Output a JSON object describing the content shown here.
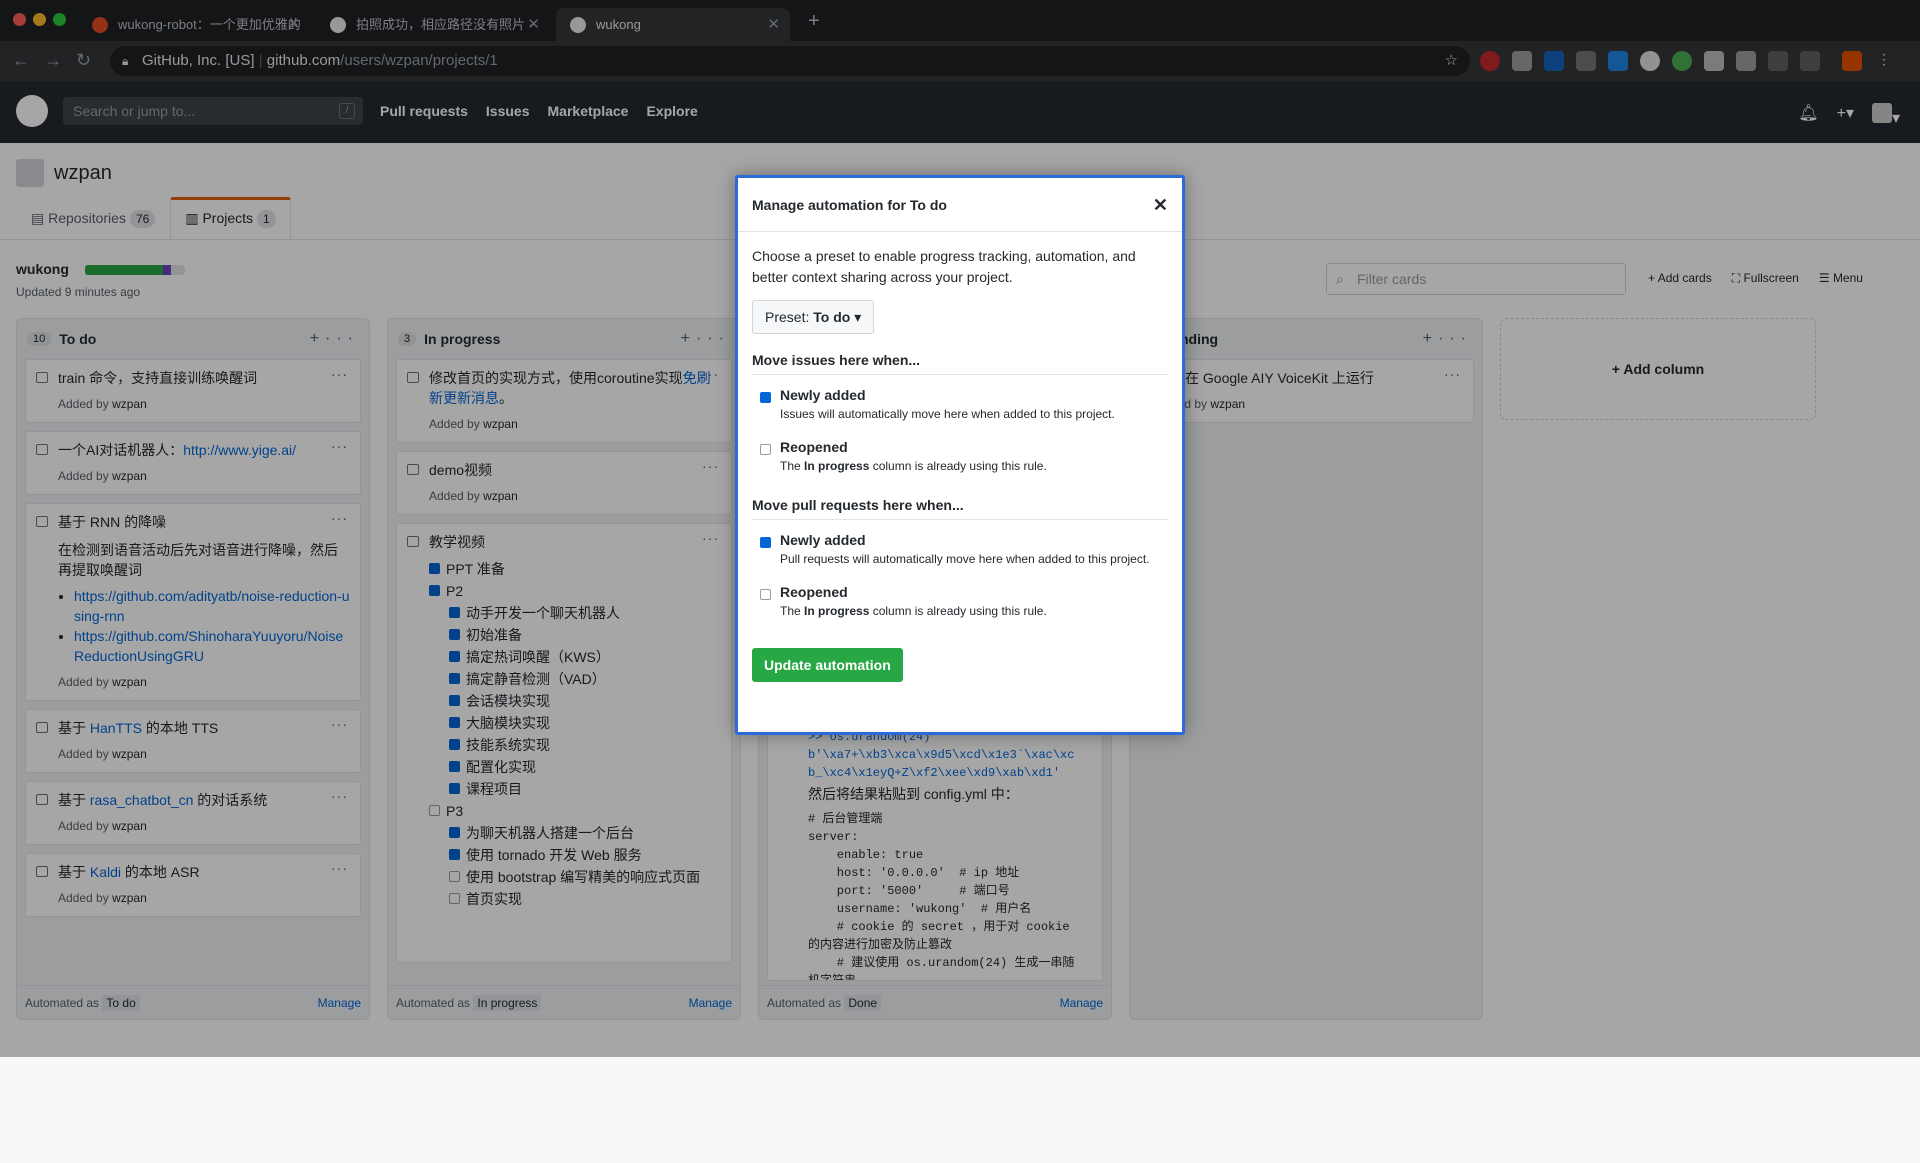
{
  "browser": {
    "tabs": [
      {
        "title": "wukong-robot：一个更加优雅的"
      },
      {
        "title": "拍照成功，相应路径没有照片 · "
      },
      {
        "title": "wukong"
      }
    ],
    "security_label": "GitHub, Inc. [US]",
    "url_host": "github.com",
    "url_path": "/users/wzpan/projects/1"
  },
  "gh": {
    "search_placeholder": "Search or jump to...",
    "search_key": "/",
    "nav": [
      "Pull requests",
      "Issues",
      "Marketplace",
      "Explore"
    ]
  },
  "user": {
    "name": "wzpan",
    "tabs": [
      {
        "label": "Repositories",
        "count": "76"
      },
      {
        "label": "Projects",
        "count": "1"
      }
    ]
  },
  "project": {
    "name": "wukong",
    "progress_done": 0.78,
    "progress_in_progress": 0.08,
    "updated": "Updated 9 minutes ago",
    "filter_placeholder": "Filter cards",
    "actions": [
      "Add cards",
      "Fullscreen",
      "Menu"
    ]
  },
  "columns": {
    "todo": {
      "count": "10",
      "title": "To do",
      "cards": [
        {
          "text": "train 命令，支持直接训练唤醒词",
          "by_prefix": "Added by",
          "by": "wzpan"
        },
        {
          "text": "一个AI对话机器人：",
          "link": "http://www.yige.ai/",
          "by_prefix": "Added by",
          "by": "wzpan"
        },
        {
          "text": "基于 RNN 的降噪",
          "body": "在检测到语音活动后先对语音进行降噪，然后再提取唤醒词",
          "links": [
            "https://github.com/adityatb/noise-reduction-using-rnn",
            "https://github.com/ShinoharaYuuyoru/NoiseReductionUsingGRU"
          ],
          "by_prefix": "Added by",
          "by": "wzpan"
        },
        {
          "pre": "基于 ",
          "link": "HanTTS",
          "post": " 的本地 TTS",
          "by_prefix": "Added by",
          "by": "wzpan"
        },
        {
          "pre": "基于 ",
          "link": "rasa_chatbot_cn",
          "post": " 的对话系统",
          "by_prefix": "Added by",
          "by": "wzpan"
        },
        {
          "pre": "基于 ",
          "link": "Kaldi",
          "post": " 的本地 ASR",
          "by_prefix": "Added by",
          "by": "wzpan"
        }
      ],
      "footer_prefix": "Automated as",
      "footer_tag": "To do",
      "manage": "Manage"
    },
    "inprogress": {
      "count": "3",
      "title": "In progress",
      "cards": [
        {
          "text": "修改首页的实现方式，使用coroutine实现",
          "link": "免刷新更新消息",
          "post": "。",
          "by_prefix": "Added by",
          "by": "wzpan"
        },
        {
          "text": "demo视频",
          "by_prefix": "Added by",
          "by": "wzpan"
        },
        {
          "text": "教学视频"
        }
      ],
      "checklist": [
        {
          "label": "PPT 准备",
          "checked": true,
          "level": 0
        },
        {
          "label": "P2",
          "checked": true,
          "level": 0
        },
        {
          "label": "动手开发一个聊天机器人",
          "checked": true,
          "level": 1
        },
        {
          "label": "初始准备",
          "checked": true,
          "level": 1
        },
        {
          "label": "搞定热词唤醒（KWS）",
          "checked": true,
          "level": 1
        },
        {
          "label": "搞定静音检测（VAD）",
          "checked": true,
          "level": 1
        },
        {
          "label": "会话模块实现",
          "checked": true,
          "level": 1
        },
        {
          "label": "大脑模块实现",
          "checked": true,
          "level": 1
        },
        {
          "label": "技能系统实现",
          "checked": true,
          "level": 1
        },
        {
          "label": "配置化实现",
          "checked": true,
          "level": 1
        },
        {
          "label": "课程项目",
          "checked": true,
          "level": 1
        },
        {
          "label": "P3",
          "checked": false,
          "level": 0
        },
        {
          "label": "为聊天机器人搭建一个后台",
          "checked": true,
          "level": 1
        },
        {
          "label": "使用 tornado 开发 Web 服务",
          "checked": true,
          "level": 1
        },
        {
          "label": "使用 bootstrap 编写精美的响应式页面",
          "checked": false,
          "level": 1
        },
        {
          "label": "首页实现",
          "checked": false,
          "level": 1
        }
      ],
      "footer_prefix": "Automated as",
      "footer_tag": "In progress",
      "manage": "Manage"
    },
    "done": {
      "code_lines": [
        ">> os.urandom(24)",
        "b'\\xa7+\\xb3\\xca\\x9d5\\xcd\\x1e3`\\xac\\xc",
        "b_\\xc4\\x1eyQ+Z\\xf2\\xee\\xd9\\xab\\xd1'"
      ],
      "paste_note": "然后将结果粘贴到 config.yml 中：",
      "yaml_lines": [
        "# 后台管理端",
        "server:",
        "    enable: true",
        "    host: '0.0.0.0'  # ip 地址",
        "    port: '5000'     # 端口号",
        "    username: 'wukong'  # 用户名",
        "    # cookie 的 secret ，用于对 cookie",
        "的内容进行加密及防止篡改",
        "    # 建议使用 os.urandom(24) 生成一串随",
        "机字符串"
      ],
      "footer_prefix": "Automated as",
      "footer_tag": "Done",
      "manage": "Manage"
    },
    "pending": {
      "title_fragment": "nding",
      "cards": [
        {
          "text": "试在 Google AIY VoiceKit 上运行",
          "by_prefix": "ded by",
          "by": "wzpan"
        }
      ]
    },
    "add_column": "Add column"
  },
  "dialog": {
    "title": "Manage automation for To do",
    "intro": "Choose a preset to enable progress tracking, automation, and better context sharing across your project.",
    "preset_prefix": "Preset:",
    "preset_value": "To do",
    "issues_heading": "Move issues here when...",
    "issues_options": [
      {
        "label": "Newly added",
        "checked": true,
        "desc": "Issues will automatically move here when added to this project."
      },
      {
        "label": "Reopened",
        "checked": false,
        "desc_pre": "The ",
        "desc_bold": "In progress",
        "desc_post": " column is already using this rule."
      }
    ],
    "pr_heading": "Move pull requests here when...",
    "pr_options": [
      {
        "label": "Newly added",
        "checked": true,
        "desc": "Pull requests will automatically move here when added to this project."
      },
      {
        "label": "Reopened",
        "checked": false,
        "desc_pre": "The ",
        "desc_bold": "In progress",
        "desc_post": " column is already using this rule."
      }
    ],
    "update_button": "Update automation"
  },
  "colors": {
    "accent": "#0366d6",
    "green": "#28a745",
    "purple": "#6f42c1",
    "dialog_border": "#2a6bd8"
  }
}
